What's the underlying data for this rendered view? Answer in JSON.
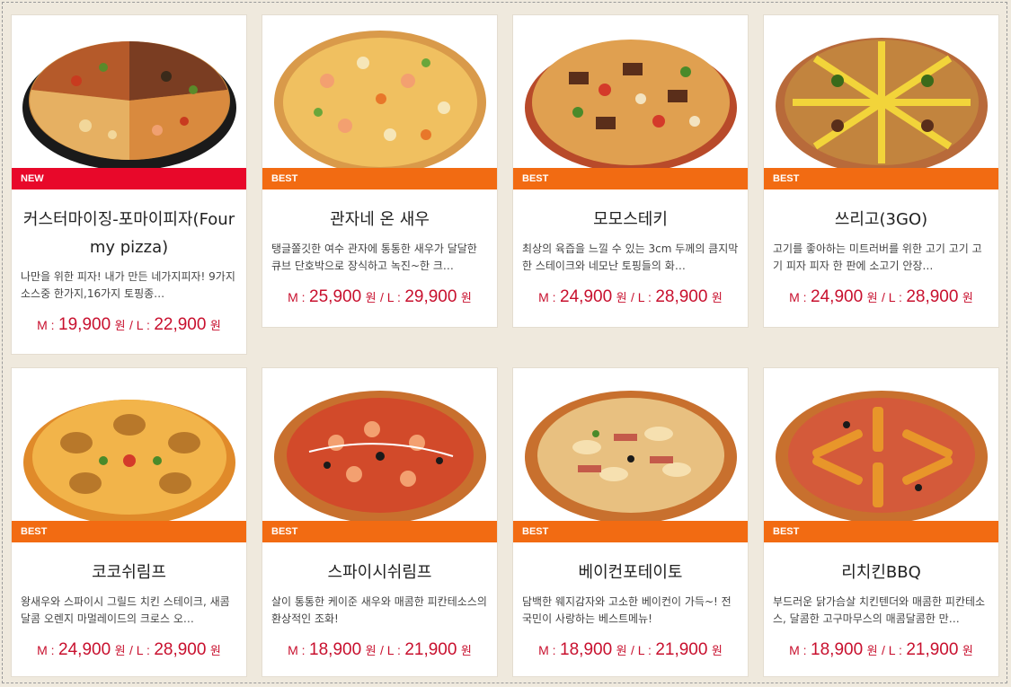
{
  "colors": {
    "new_badge": "#e8082a",
    "best_badge": "#f26b12",
    "price": "#c8102e"
  },
  "pizzas": [
    {
      "badge": "NEW",
      "title": "커스터마이징-포마이피자(Four my pizza)",
      "desc": "나만을 위한 피자! 내가 만든 네가지피자! 9가지 소스중 한가지,16가지 토핑종…",
      "price_m": "19,900",
      "price_l": "22,900"
    },
    {
      "badge": "BEST",
      "title": "관자네 온 새우",
      "desc": "탱글쫄깃한 여수 관자에 통통한 새우가 달달한 큐브 단호박으로 장식하고 녹진~한 크…",
      "price_m": "25,900",
      "price_l": "29,900"
    },
    {
      "badge": "BEST",
      "title": "모모스테키",
      "desc": "최상의 육즙을 느낄 수 있는 3cm 두께의 큼지막한 스테이크와 네모난 토핑들의 화…",
      "price_m": "24,900",
      "price_l": "28,900"
    },
    {
      "badge": "BEST",
      "title": "쓰리고(3GO)",
      "desc": "고기를 좋아하는 미트러버를 위한 고기 고기 고기 피자 피자 한 판에 소고기 안장…",
      "price_m": "24,900",
      "price_l": "28,900"
    },
    {
      "badge": "BEST",
      "title": "코코쉬림프",
      "desc": "왕새우와 스파이시 그릴드 치킨 스테이크, 새콤달콤 오렌지 마멀레이드의 크로스 오…",
      "price_m": "24,900",
      "price_l": "28,900"
    },
    {
      "badge": "BEST",
      "title": "스파이시쉬림프",
      "desc": "살이 통통한 케이준 새우와 매콤한 피칸테소스의 환상적인 조화!",
      "price_m": "18,900",
      "price_l": "21,900"
    },
    {
      "badge": "BEST",
      "title": "베이컨포테이토",
      "desc": "담백한 웨지감자와 고소한 베이컨이 가득~! 전 국민이 사랑하는 베스트메뉴!",
      "price_m": "18,900",
      "price_l": "21,900"
    },
    {
      "badge": "BEST",
      "title": "리치킨BBQ",
      "desc": "부드러운 닭가슴살 치킨텐더와 매콤한 피칸테소스, 달콤한 고구마무스의 매콤달콤한 만…",
      "price_m": "18,900",
      "price_l": "21,900"
    }
  ],
  "labels": {
    "m": "M :",
    "l": "/ L :",
    "won": "원"
  }
}
